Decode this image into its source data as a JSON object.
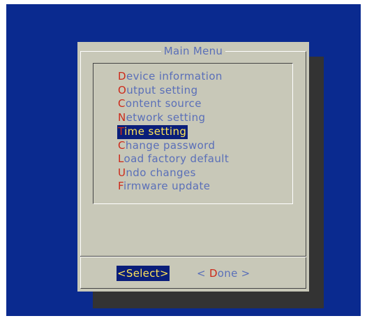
{
  "colors": {
    "desktop_bg": "#0a2a8f",
    "dialog_bg": "#c8c8b8",
    "shadow": "#333333",
    "text": "#5a6fb8",
    "hotkey": "#cc2a1a",
    "selected_bg": "#0a1e7a",
    "selected_fg": "#ffe35a",
    "title_text": "#5a6fb8"
  },
  "dialog": {
    "title": "Main Menu"
  },
  "menu": {
    "selected_index": 4,
    "items": [
      {
        "hotkey": "D",
        "rest": "evice information"
      },
      {
        "hotkey": "O",
        "rest": "utput setting"
      },
      {
        "hotkey": "C",
        "rest": "ontent source"
      },
      {
        "hotkey": "N",
        "rest": "etwork setting"
      },
      {
        "hotkey": "T",
        "rest": "ime setting"
      },
      {
        "hotkey": "C",
        "rest": "hange password"
      },
      {
        "hotkey": "L",
        "rest": "oad factory default"
      },
      {
        "hotkey": "U",
        "rest": "ndo changes"
      },
      {
        "hotkey": "F",
        "rest": "irmware update"
      }
    ]
  },
  "buttons": {
    "select": {
      "label": "<Select>"
    },
    "done": {
      "pre": "< ",
      "hotkey": "D",
      "rest": "one >"
    }
  }
}
